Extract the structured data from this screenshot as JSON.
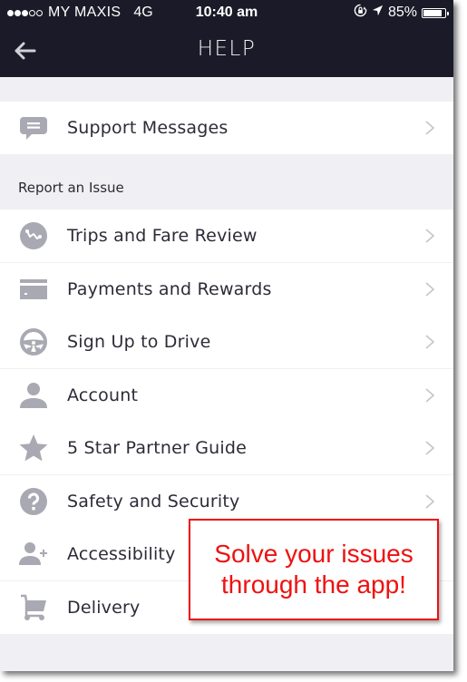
{
  "status_bar": {
    "signal_bars_filled": 3,
    "signal_bars_total": 5,
    "carrier": "MY MAXIS",
    "network": "4G",
    "time": "10:40 am",
    "rotation_lock_icon": "rotation-lock-icon",
    "location_icon": "location-arrow-icon",
    "battery_percent_label": "85%",
    "battery_level": 0.85
  },
  "nav": {
    "back_icon": "arrow-left-icon",
    "title": "HELP"
  },
  "support": {
    "label": "Support Messages",
    "icon": "chat-bubble-icon"
  },
  "report_section": {
    "header": "Report an Issue",
    "items": [
      {
        "label": "Trips and Fare Review",
        "icon": "trip-route-icon",
        "chevron": true
      },
      {
        "label": "Payments and Rewards",
        "icon": "credit-card-icon",
        "chevron": true
      },
      {
        "label": "Sign Up to Drive",
        "icon": "steering-wheel-icon",
        "chevron": true
      },
      {
        "label": "Account",
        "icon": "person-icon",
        "chevron": true
      },
      {
        "label": "5 Star Partner Guide",
        "icon": "star-icon",
        "chevron": true
      },
      {
        "label": "Safety and Security",
        "icon": "question-circle-icon",
        "chevron": true
      },
      {
        "label": "Accessibility",
        "icon": "person-add-icon",
        "chevron": false
      },
      {
        "label": "Delivery",
        "icon": "shopping-cart-icon",
        "chevron": false
      }
    ]
  },
  "callout": {
    "text": "Solve your issues through the app!",
    "color": "#ee1111"
  },
  "colors": {
    "header_bg": "#1b1a28",
    "list_bg": "#ffffff",
    "group_bg": "#efeff4",
    "icon_gray": "#a9a9b3",
    "chevron_gray": "#c4c4cc",
    "text": "#2c2c38"
  }
}
